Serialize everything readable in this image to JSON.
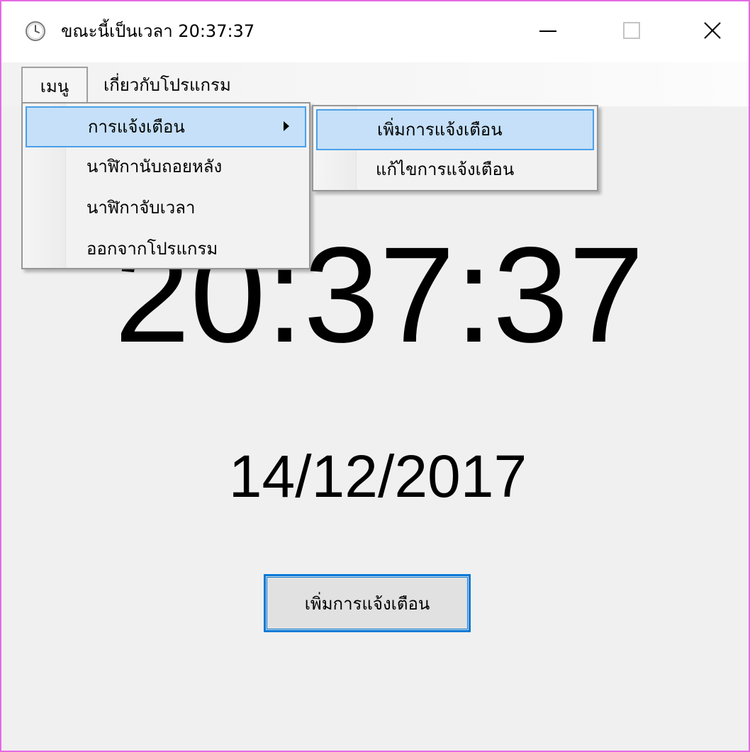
{
  "window": {
    "title": "ขณะนี้เป็นเวลา 20:37:37"
  },
  "menubar": {
    "menu_label": "เมนู",
    "about_label": "เกี่ยวกับโปรแกรม"
  },
  "dropdown": {
    "items": [
      {
        "label": "การแจ้งเตือน"
      },
      {
        "label": "นาฬิกานับถอยหลัง"
      },
      {
        "label": "นาฬิกาจับเวลา"
      },
      {
        "label": "ออกจากโปรแกรม"
      }
    ]
  },
  "submenu": {
    "items": [
      {
        "label": "เพิ่มการแจ้งเตือน"
      },
      {
        "label": "แก้ไขการแจ้งเตือน"
      }
    ]
  },
  "main": {
    "time": "20:37:37",
    "date": "14/12/2017",
    "add_button_label": "เพิ่มการแจ้งเตือน"
  },
  "icons": {
    "app": "clock-icon",
    "minimize": "minimize-icon",
    "maximize": "maximize-icon",
    "close": "close-icon",
    "submenu_arrow": "chevron-right-icon"
  },
  "colors": {
    "accent": "#0078d7",
    "highlight": "#c5e0f8",
    "window_border": "#e56ae5"
  }
}
